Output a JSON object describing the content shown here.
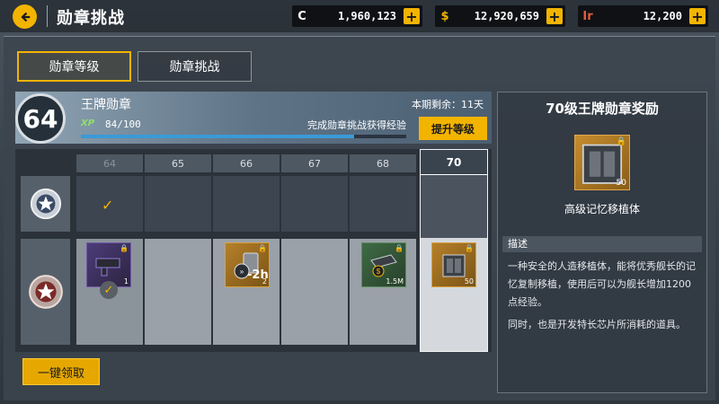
{
  "header": {
    "title": "勋章挑战",
    "currencies": [
      {
        "icon": "C",
        "icon_color": "#ffffff",
        "value": "1,960,123"
      },
      {
        "icon": "$",
        "icon_color": "#f3b400",
        "value": "12,920,659"
      },
      {
        "icon": "Ir",
        "icon_color": "#e35d3a",
        "value": "12,200"
      }
    ]
  },
  "tabs": [
    {
      "label": "勋章等级",
      "active": true
    },
    {
      "label": "勋章挑战",
      "active": false
    }
  ],
  "badge": {
    "level": "64",
    "name": "王牌勋章",
    "season_remaining": "本期剩余：11天",
    "xp_label": "XP",
    "xp_value": "84/100",
    "xp_progress": 0.84,
    "xp_hint": "完成勋章挑战获得经验",
    "upgrade_label": "提升等级"
  },
  "levels": [
    "64",
    "65",
    "66",
    "67",
    "68",
    "70"
  ],
  "rewards_row": [
    {
      "level": "64",
      "item": "purple-weapon",
      "locked": true,
      "qty": "1",
      "claimed": true
    },
    {
      "level": "65",
      "item": null
    },
    {
      "level": "66",
      "item": "speedup-2h",
      "locked": true,
      "qty": "2",
      "overlay": "-2h"
    },
    {
      "level": "67",
      "item": null
    },
    {
      "level": "68",
      "item": "money-case",
      "locked": true,
      "qty": "1.5M"
    },
    {
      "level": "70",
      "item": "memory-implant",
      "locked": true,
      "qty": "50"
    }
  ],
  "claim_all_label": "一键领取",
  "reward_panel": {
    "title": "70级王牌勋章奖励",
    "item_name": "高级记忆移植体",
    "item_qty": "50",
    "desc_heading": "描述",
    "desc_line1": "一种安全的人造移植体，能将优秀舰长的记忆复制移植，使用后可以为舰长增加1200点经验。",
    "desc_line2": "同时，也是开发特长芯片所消耗的道具。"
  },
  "colors": {
    "accent": "#f3b400",
    "xp_bar": "#3a9ad8"
  }
}
